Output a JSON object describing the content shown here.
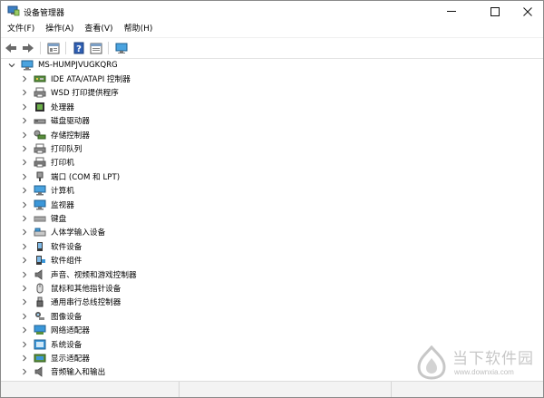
{
  "window": {
    "title": "设备管理器",
    "icon": "device-manager-icon"
  },
  "menu": {
    "items": [
      {
        "label": "文件(F)"
      },
      {
        "label": "操作(A)"
      },
      {
        "label": "查看(V)"
      },
      {
        "label": "帮助(H)"
      }
    ]
  },
  "toolbar": {
    "items": [
      "back-arrow-icon",
      "forward-arrow-icon",
      "properties-icon",
      "help-icon",
      "update-driver-icon",
      "monitor-icon"
    ]
  },
  "tree": {
    "root": {
      "label": "MS-HUMPJVUGKQRG",
      "icon": "computer-icon"
    },
    "categories": [
      {
        "label": "IDE ATA/ATAPI 控制器",
        "icon": "ide-controller-icon"
      },
      {
        "label": "WSD 打印提供程序",
        "icon": "wsd-printer-icon"
      },
      {
        "label": "处理器",
        "icon": "processor-icon"
      },
      {
        "label": "磁盘驱动器",
        "icon": "disk-drive-icon"
      },
      {
        "label": "存储控制器",
        "icon": "storage-controller-icon"
      },
      {
        "label": "打印队列",
        "icon": "print-queue-icon"
      },
      {
        "label": "打印机",
        "icon": "printer-icon"
      },
      {
        "label": "端口 (COM 和 LPT)",
        "icon": "port-icon"
      },
      {
        "label": "计算机",
        "icon": "computer-icon"
      },
      {
        "label": "监视器",
        "icon": "monitor-icon"
      },
      {
        "label": "键盘",
        "icon": "keyboard-icon"
      },
      {
        "label": "人体学输入设备",
        "icon": "hid-icon"
      },
      {
        "label": "软件设备",
        "icon": "software-device-icon"
      },
      {
        "label": "软件组件",
        "icon": "software-component-icon"
      },
      {
        "label": "声音、视频和游戏控制器",
        "icon": "speaker-icon"
      },
      {
        "label": "鼠标和其他指针设备",
        "icon": "mouse-icon"
      },
      {
        "label": "通用串行总线控制器",
        "icon": "usb-icon"
      },
      {
        "label": "图像设备",
        "icon": "camera-icon"
      },
      {
        "label": "网络适配器",
        "icon": "network-adapter-icon"
      },
      {
        "label": "系统设备",
        "icon": "system-device-icon"
      },
      {
        "label": "显示适配器",
        "icon": "display-adapter-icon"
      },
      {
        "label": "音频输入和输出",
        "icon": "audio-io-icon"
      }
    ]
  },
  "watermark": {
    "name": "当下软件园",
    "url": "www.downxia.com"
  }
}
